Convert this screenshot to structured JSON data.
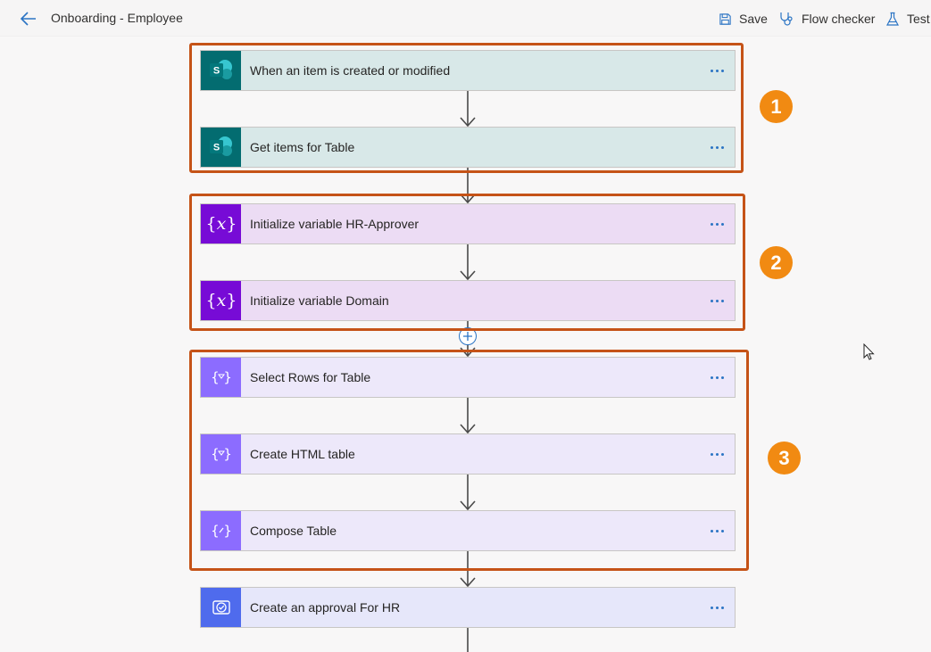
{
  "header": {
    "title": "Onboarding - Employee",
    "save_label": "Save",
    "flow_checker_label": "Flow checker",
    "test_label": "Test"
  },
  "steps": [
    {
      "label": "When an item is created or modified",
      "icon": "sharepoint-icon"
    },
    {
      "label": "Get items for Table",
      "icon": "sharepoint-icon"
    },
    {
      "label": "Initialize variable HR-Approver",
      "icon": "variable-icon"
    },
    {
      "label": "Initialize variable Domain",
      "icon": "variable-icon"
    },
    {
      "label": "Select Rows for Table",
      "icon": "data-operation-icon"
    },
    {
      "label": "Create HTML table",
      "icon": "data-operation-icon"
    },
    {
      "label": "Compose Table",
      "icon": "compose-icon"
    },
    {
      "label": "Create an approval For HR",
      "icon": "approval-icon"
    }
  ],
  "badges": [
    "1",
    "2",
    "3"
  ],
  "colors": {
    "sharepoint": "#036c70",
    "variable": "#770bd6",
    "data_operation": "#8c6cff",
    "approval": "#4f6bed",
    "group_border": "#c55317",
    "badge": "#f18a12",
    "accent": "#2b74c4"
  }
}
